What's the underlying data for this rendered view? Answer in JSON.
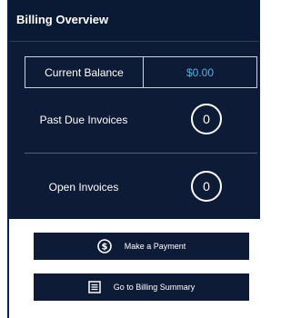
{
  "header": {
    "title": "Billing Overview"
  },
  "balance": {
    "label": "Current Balance",
    "value": "$0.00"
  },
  "stats": {
    "past_due": {
      "label": "Past Due Invoices",
      "count": "0"
    },
    "open": {
      "label": "Open Invoices",
      "count": "0"
    }
  },
  "actions": {
    "make_payment": {
      "label": "Make a Payment",
      "icon": "dollar-circle-icon"
    },
    "billing_summary": {
      "label": "Go to Billing Summary",
      "icon": "document-list-icon"
    }
  },
  "colors": {
    "panel_navy": "#0d1b36",
    "balance_accent": "#4fb3e8",
    "text_white": "#ffffff"
  }
}
